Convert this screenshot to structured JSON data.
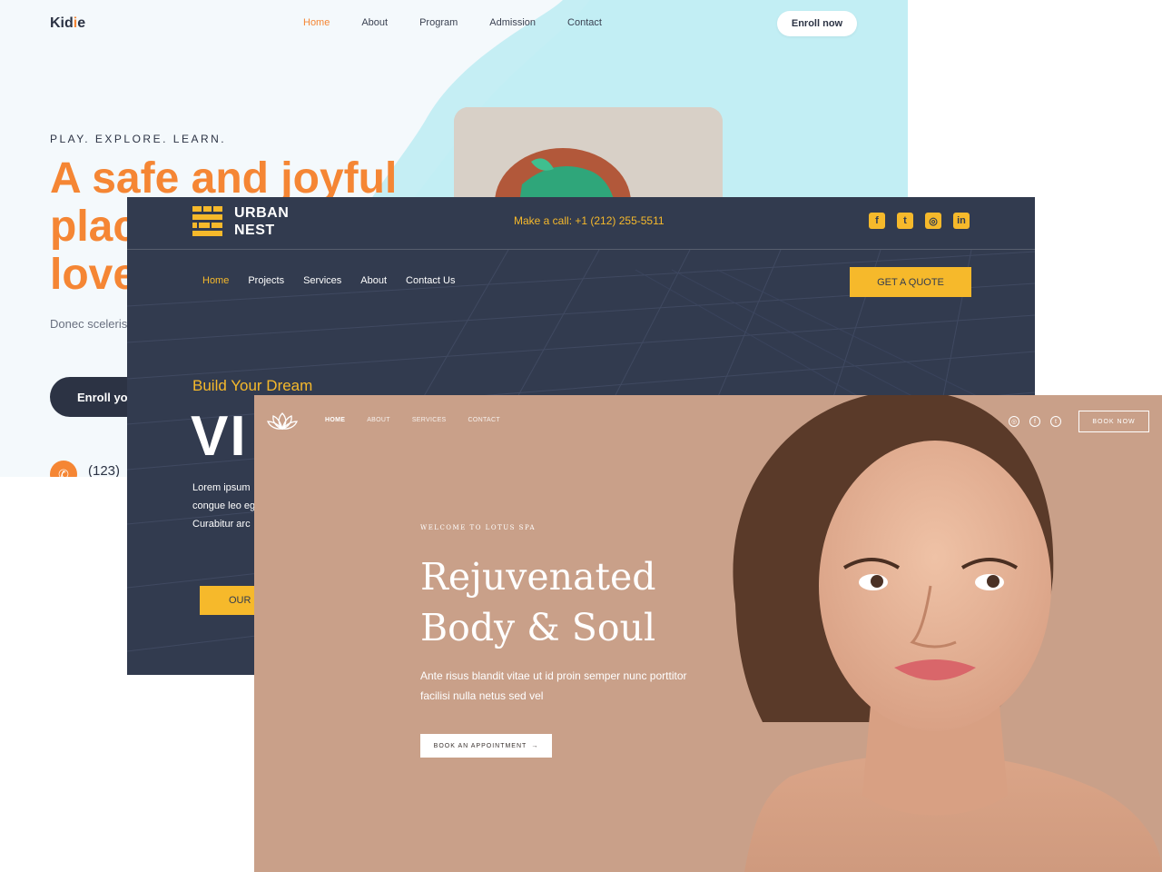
{
  "kidie": {
    "logo_pre": "Kid",
    "logo_mid": "i",
    "logo_post": "e",
    "nav": [
      "Home",
      "About",
      "Program",
      "Admission",
      "Contact"
    ],
    "enroll_button": "Enroll now",
    "tagline": "PLAY. EXPLORE. LEARN.",
    "headline": "A safe and joyful place to learn and love",
    "body": "Donec scelerisque bibendum arcu",
    "cta": "Enroll yo",
    "phone": "(123)",
    "colors": {
      "accent": "#f58634",
      "dark": "#2c3344"
    }
  },
  "urban": {
    "logo_line1": "URBAN",
    "logo_line2": "NEST",
    "call": "Make a call: +1 (212) 255-5511",
    "social_icons": [
      "facebook-icon",
      "twitter-icon",
      "instagram-icon",
      "linkedin-icon"
    ],
    "social_glyphs": [
      "f",
      "t",
      "◎",
      "in"
    ],
    "nav": [
      "Home",
      "Projects",
      "Services",
      "About",
      "Contact Us"
    ],
    "quote_button": "GET A QUOTE",
    "kicker": "Build Your Dream",
    "big_text": "VI",
    "lorem_lines": [
      "Lorem ipsum",
      "congue leo eg",
      "Curabitur arc"
    ],
    "our_button": "OUR S",
    "colors": {
      "accent": "#f6b92b",
      "bg": "#323b4f"
    }
  },
  "lotus": {
    "nav": [
      "HOME",
      "ABOUT",
      "SERVICES",
      "CONTACT"
    ],
    "social_icons": [
      "instagram-icon",
      "facebook-icon",
      "twitter-icon"
    ],
    "social_glyphs": [
      "◎",
      "f",
      "t"
    ],
    "book_now": "BOOK NOW",
    "welcome": "WELCOME TO LOTUS SPA",
    "headline_line1": "Rejuvenated",
    "headline_line2": "Body & Soul",
    "body": "Ante risus blandit vitae ut id proin semper nunc porttitor facilisi nulla netus sed vel",
    "cta": "BOOK AN APPOINTMENT",
    "cta_arrow": "→",
    "colors": {
      "bg": "#c9a089"
    }
  }
}
